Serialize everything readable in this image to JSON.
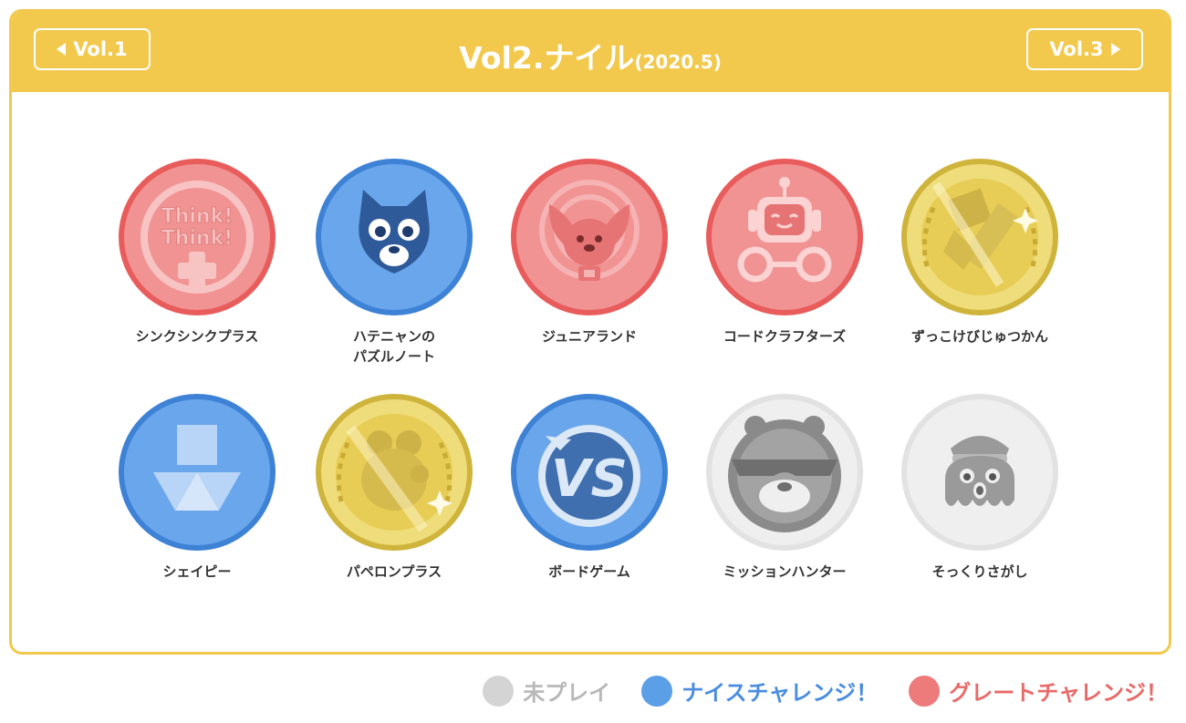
{
  "header": {
    "title": "Vol2.ナイル",
    "subtitle": "(2020.5)",
    "prev_label": "Vol.1",
    "next_label": "Vol.3"
  },
  "colors": {
    "header_yellow": "#f2c94c",
    "red_medal": "#ee7b7b",
    "blue_medal": "#5b9fe6",
    "gold_medal": "#e7cf52",
    "gray_medal": "#d4d4d4"
  },
  "medals": [
    {
      "label": "シンクシンクプラス",
      "status": "great",
      "icon": "think-think-plus-icon"
    },
    {
      "label": "ハテニャンの\nパズルノート",
      "status": "nice",
      "icon": "hatenyan-cat-icon"
    },
    {
      "label": "ジュニアランド",
      "status": "great",
      "icon": "bird-character-icon"
    },
    {
      "label": "コードクラフターズ",
      "status": "great",
      "icon": "robot-icon"
    },
    {
      "label": "ずっこけびじゅつかん",
      "status": "gold",
      "icon": "paintbrush-icon"
    },
    {
      "label": "シェイピー",
      "status": "nice",
      "icon": "shapes-icon"
    },
    {
      "label": "パペロンプラス",
      "status": "gold",
      "icon": "bear-icon"
    },
    {
      "label": "ボードゲーム",
      "status": "nice",
      "icon": "vs-icon"
    },
    {
      "label": "ミッションハンター",
      "status": "unplayed",
      "icon": "masked-character-icon"
    },
    {
      "label": "そっくりさがし",
      "status": "unplayed",
      "icon": "octopus-captain-icon"
    }
  ],
  "legend": [
    {
      "label": "未プレイ",
      "color": "#d4d4d4",
      "text_color": "#b8b8b8"
    },
    {
      "label": "ナイスチャレンジ！",
      "color": "#5b9fe6",
      "text_color": "#4a8ddf"
    },
    {
      "label": "グレートチャレンジ！",
      "color": "#ee7b7b",
      "text_color": "#e86a6a"
    }
  ]
}
